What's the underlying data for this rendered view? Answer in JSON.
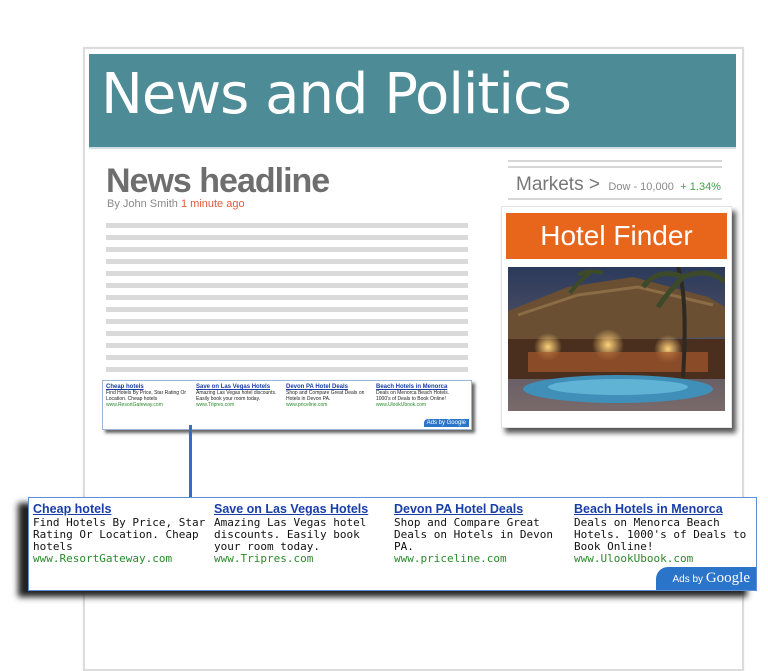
{
  "banner": {
    "title": "News and Politics",
    "color": "#4d8b97"
  },
  "article": {
    "headline": "News headline",
    "byline_prefix": "By John Smith",
    "byline_time": "1 minute ago"
  },
  "markets": {
    "label": "Markets >",
    "index": "Dow - 10,000",
    "change": "+ 1.34%"
  },
  "hotel_finder": {
    "title": "Hotel Finder",
    "accent": "#e8651c"
  },
  "ads": {
    "badge_prefix": "Ads by",
    "badge_brand": "Google",
    "items": [
      {
        "title": "Cheap hotels",
        "desc": "Find Hotels By Price, Star Rating Or Location. Cheap hotels",
        "url": "www.ResortGateway.com"
      },
      {
        "title": "Save on Las Vegas Hotels",
        "desc": "Amazing Las Vegas hotel discounts. Easily book your room today.",
        "url": "www.Tripres.com"
      },
      {
        "title": "Devon PA Hotel Deals",
        "desc": "Shop and Compare Great Deals on Hotels in Devon PA.",
        "url": "www.priceline.com"
      },
      {
        "title": "Beach Hotels in Menorca",
        "desc": "Deals on Menorca Beach Hotels. 1000's of Deals to Book Online!",
        "url": "www.UlookUbook.com"
      }
    ]
  }
}
